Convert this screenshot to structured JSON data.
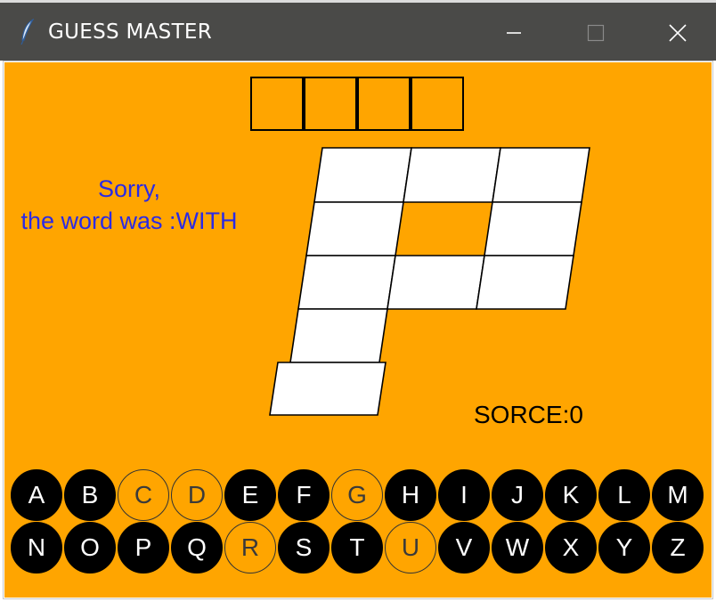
{
  "window": {
    "title": "GUESS MASTER",
    "app_icon": "feather-icon",
    "controls": [
      "minimize-icon",
      "maximize-icon",
      "close-icon"
    ]
  },
  "colors": {
    "background": "#ffa500",
    "message": "#2a2ae6",
    "key_unused_bg": "#000000",
    "key_unused_fg": "#ffffff",
    "key_used_fg": "#3a3a3a",
    "hangman_fill": "#ffffff"
  },
  "game": {
    "message_line1": "Sorry,",
    "message_line2": "the word was :WITH",
    "score": "SORCE:0",
    "word_slots": [
      "",
      "",
      "",
      ""
    ],
    "wrong_guesses_drawn": 5
  },
  "keyboard": {
    "row1": [
      {
        "letter": "A",
        "used": false
      },
      {
        "letter": "B",
        "used": false
      },
      {
        "letter": "C",
        "used": true
      },
      {
        "letter": "D",
        "used": true
      },
      {
        "letter": "E",
        "used": false
      },
      {
        "letter": "F",
        "used": false
      },
      {
        "letter": "G",
        "used": true
      },
      {
        "letter": "H",
        "used": false
      },
      {
        "letter": "I",
        "used": false
      },
      {
        "letter": "J",
        "used": false
      },
      {
        "letter": "K",
        "used": false
      },
      {
        "letter": "L",
        "used": false
      },
      {
        "letter": "M",
        "used": false
      }
    ],
    "row2": [
      {
        "letter": "N",
        "used": false
      },
      {
        "letter": "O",
        "used": false
      },
      {
        "letter": "P",
        "used": false
      },
      {
        "letter": "Q",
        "used": false
      },
      {
        "letter": "R",
        "used": true
      },
      {
        "letter": "S",
        "used": false
      },
      {
        "letter": "T",
        "used": false
      },
      {
        "letter": "U",
        "used": true
      },
      {
        "letter": "V",
        "used": false
      },
      {
        "letter": "W",
        "used": false
      },
      {
        "letter": "X",
        "used": false
      },
      {
        "letter": "Y",
        "used": false
      },
      {
        "letter": "Z",
        "used": false
      }
    ]
  }
}
